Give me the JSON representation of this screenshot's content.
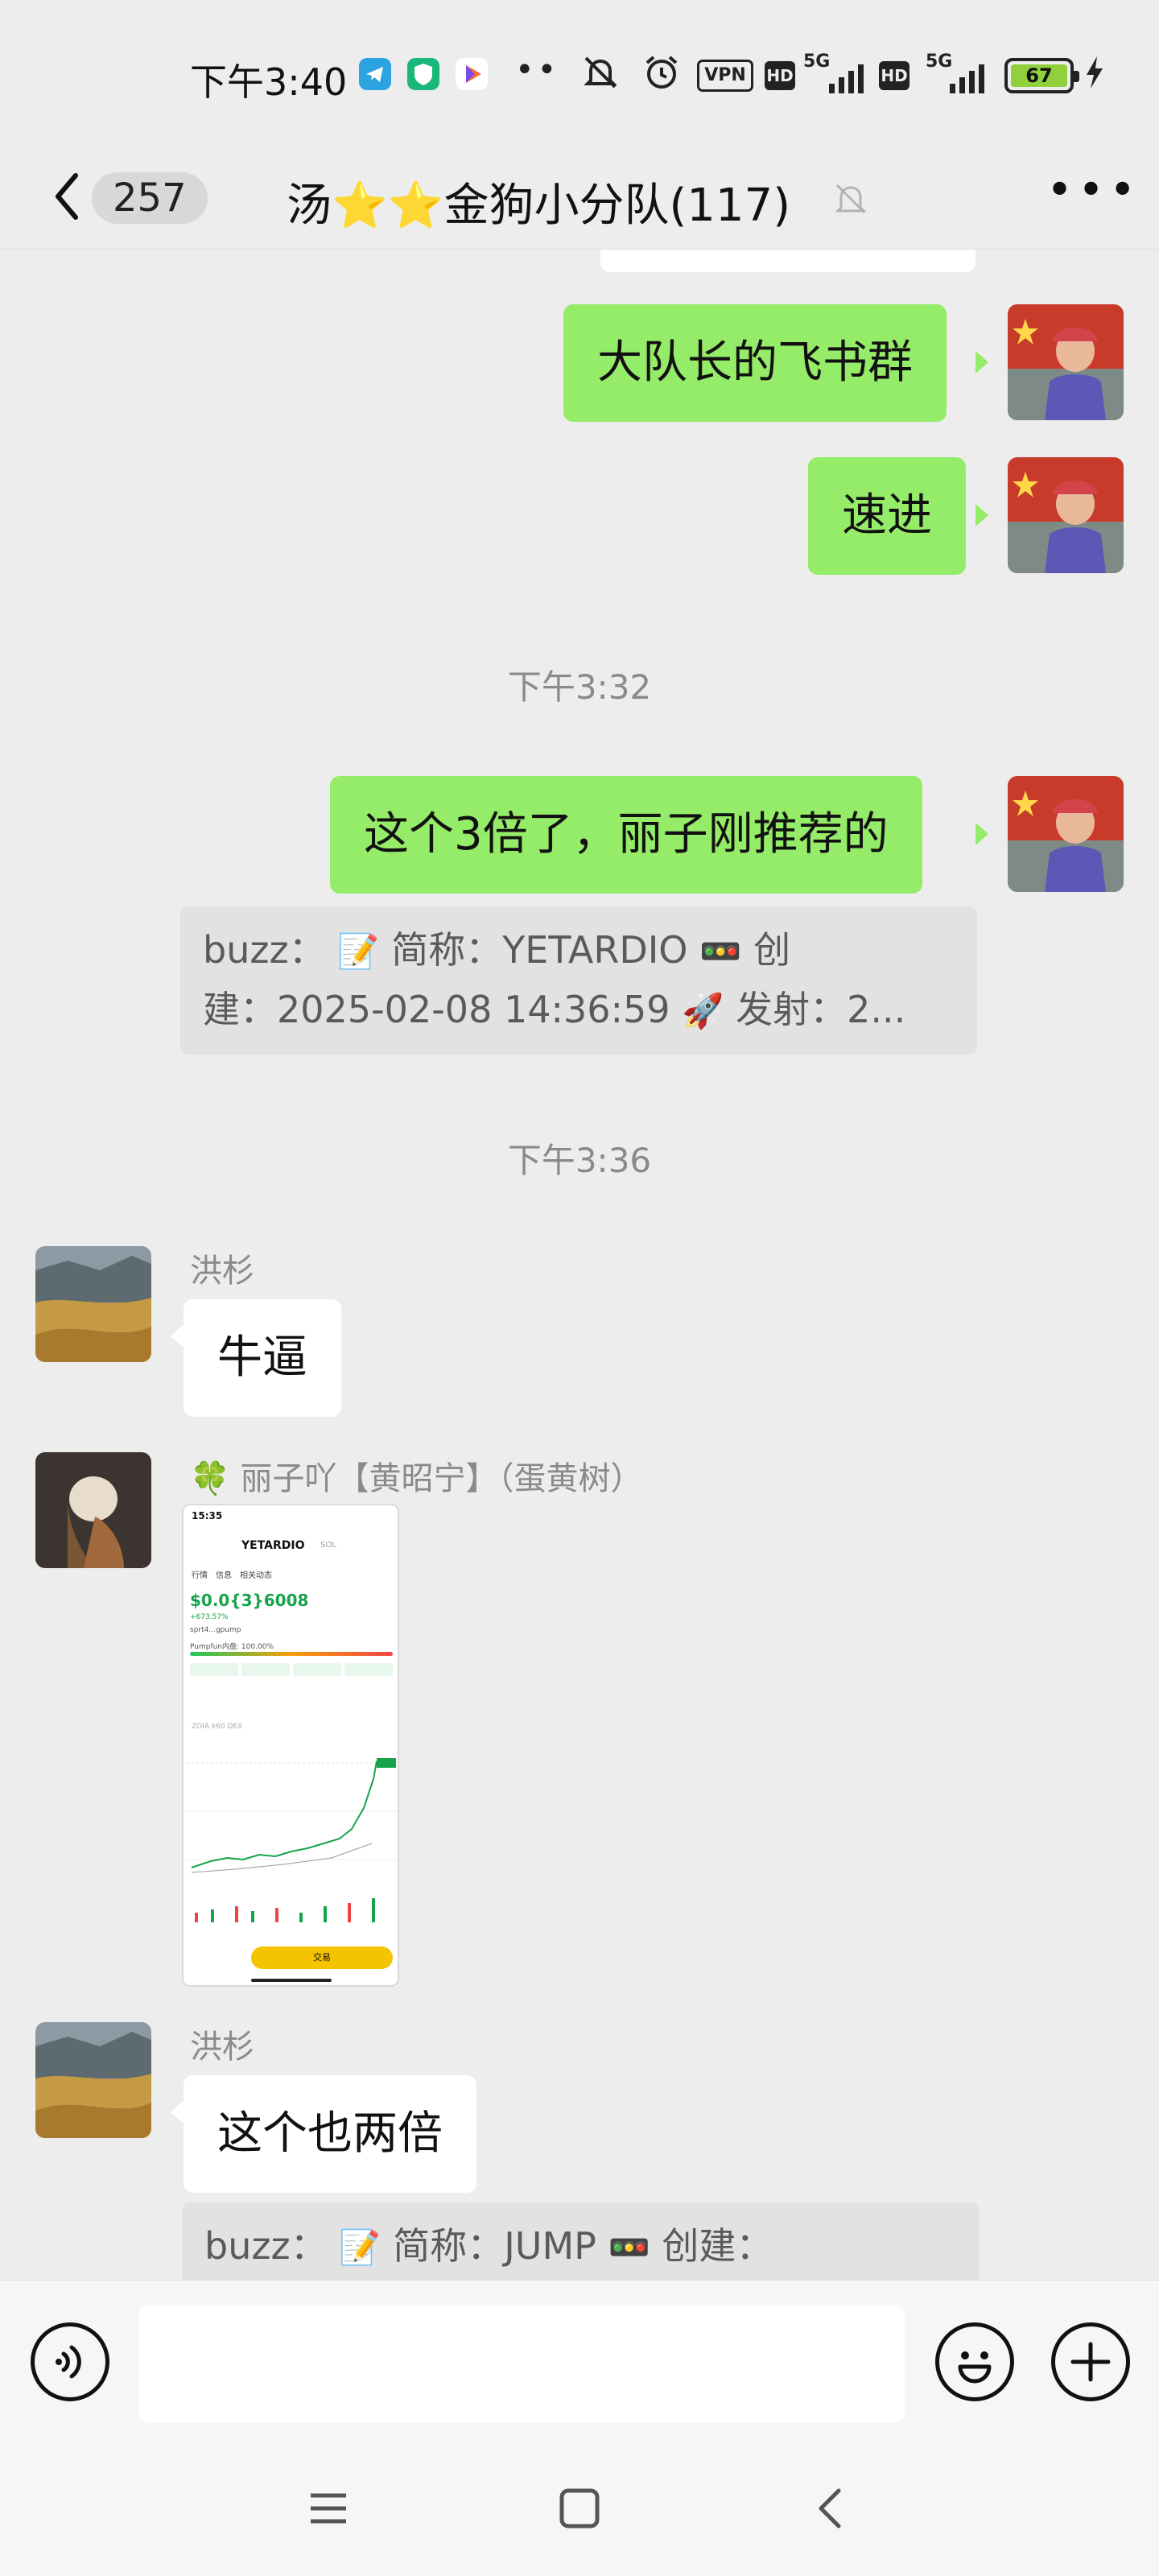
{
  "status_bar": {
    "time": "下午3:40",
    "vpn": "VPN",
    "hd1": "HD",
    "net1": "5G",
    "hd2": "HD",
    "net2": "5G",
    "battery": "67"
  },
  "header": {
    "back_count": "257",
    "title_prefix": "汤",
    "title_suffix": "金狗小分队(117)"
  },
  "messages": {
    "m1": "大队长的飞书群",
    "m2": "速进",
    "ts1": "下午3:32",
    "m3": "这个3倍了，丽子刚推荐的",
    "quote1_a": "buzz：",
    "quote1_b": "简称：YETARDIO",
    "quote1_c": "创",
    "quote1_d": "建：2025-02-08 14:36:59",
    "quote1_e": "发射：2...",
    "ts2": "下午3:36",
    "sender1": "洪杉",
    "m4": "牛逼",
    "sender2": "丽子吖【黄昭宁】（蛋黄树）",
    "sender3": "洪杉",
    "m5": "这个也两倍",
    "quote2_a": "buzz：",
    "quote2_b": "简称：JUMP",
    "quote2_c": "创建："
  },
  "shared_screenshot": {
    "time": "15:35",
    "token": "YETARDIO",
    "chain": "SOL",
    "tabs": [
      "行情",
      "信息",
      "相关动态"
    ],
    "price": "$0.0{3}6008",
    "change": "+673.57%",
    "address": "sprt4...gpump",
    "progress_label": "Pumpfun内盘: 100.00%",
    "chart_label": "ZOIA k60 DEX",
    "trade_button": "交易"
  }
}
